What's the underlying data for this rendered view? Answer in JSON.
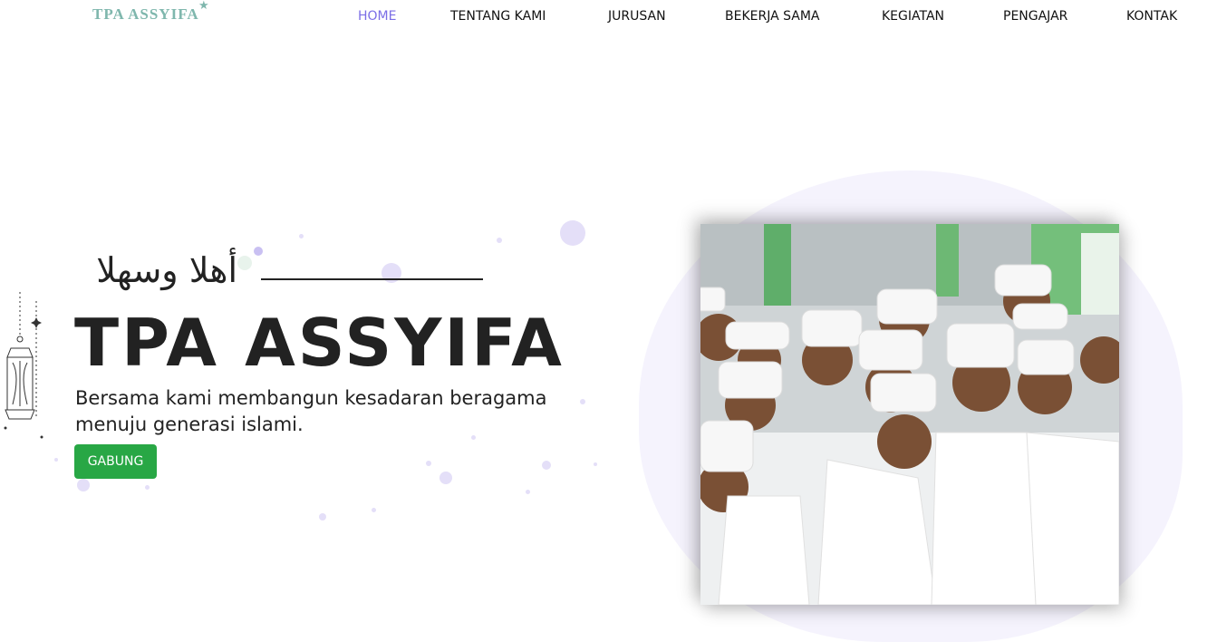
{
  "brand": {
    "logo": "TPA ASSYIFA",
    "accent": "#7b6ee6",
    "logo_color": "#7fb7ad"
  },
  "nav": {
    "items": [
      {
        "label": "HOME",
        "active": true
      },
      {
        "label": "TENTANG KAMI",
        "active": false
      },
      {
        "label": "JURUSAN",
        "active": false
      },
      {
        "label": "BEKERJA SAMA",
        "active": false
      },
      {
        "label": "KEGIATAN",
        "active": false
      },
      {
        "label": "PENGAJAR",
        "active": false
      },
      {
        "label": "KONTAK",
        "active": false
      }
    ]
  },
  "hero": {
    "arabic_greeting": "أهلا وسهلا",
    "title": "TPA ASSYIFA",
    "subtitle": "Bersama kami membangun kesadaran beragama menuju generasi islami.",
    "button_label": "GABUNG",
    "button_color": "#28a745"
  },
  "icons": [
    "lantern-icon",
    "logo-star-icon"
  ]
}
